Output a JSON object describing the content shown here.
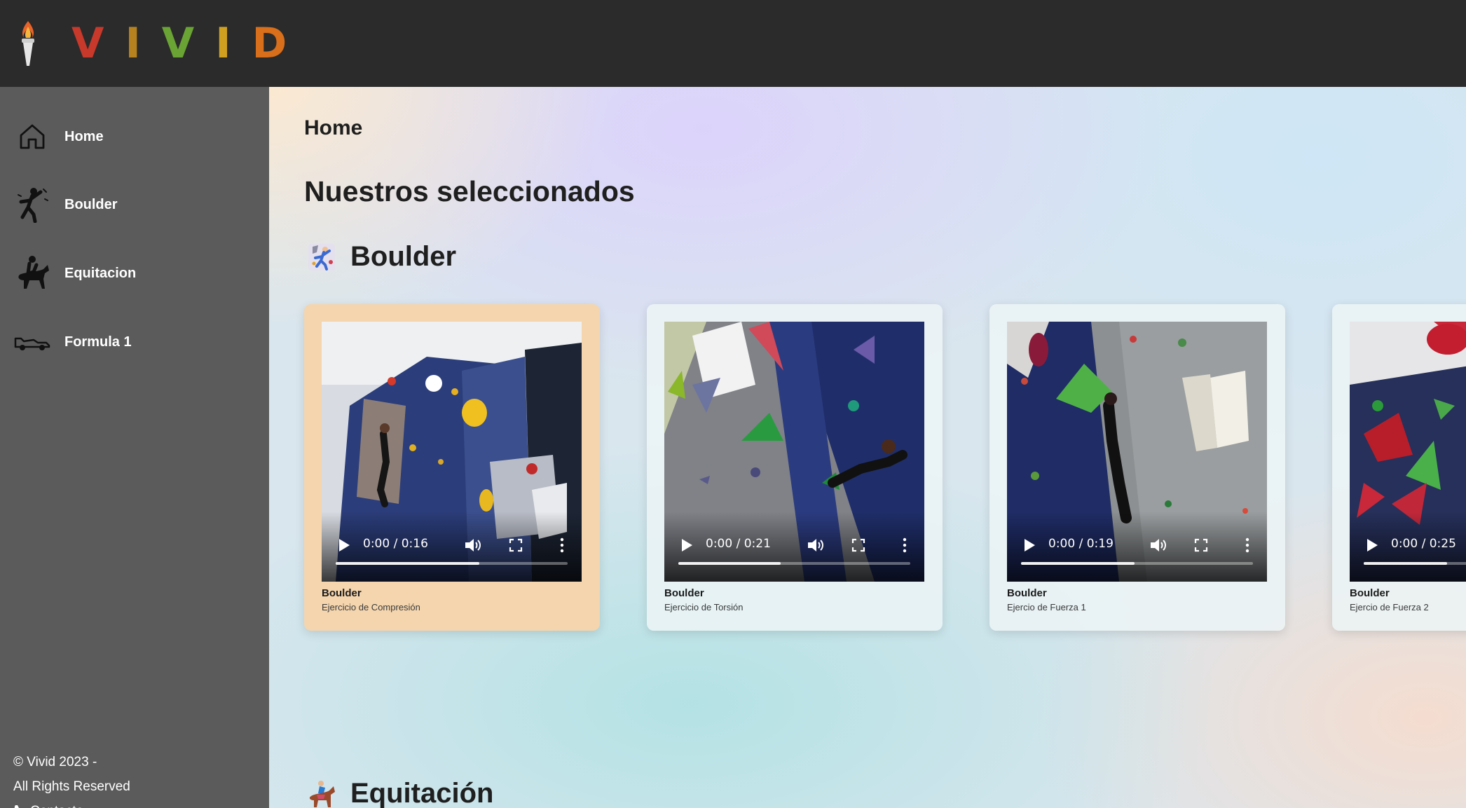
{
  "header": {
    "logo_text": [
      "V",
      "I",
      "V",
      "I",
      "D"
    ],
    "logo_colors": [
      "#c8392b",
      "#b5821f",
      "#6aa434",
      "#d0a020",
      "#d96f1a"
    ]
  },
  "sidebar": {
    "items": [
      {
        "label": "Home",
        "icon": "home-icon"
      },
      {
        "label": "Boulder",
        "icon": "climber-icon"
      },
      {
        "label": "Equitacion",
        "icon": "horse-rider-icon"
      },
      {
        "label": "Formula 1",
        "icon": "race-car-icon"
      }
    ],
    "footer": {
      "copyright": "© Vivid 2023 -",
      "rights": "All Rights Reserved",
      "contact": "Contacto"
    }
  },
  "main": {
    "breadcrumb": "Home",
    "section_title": "Nuestros seleccionados",
    "categories": [
      {
        "title": "Boulder",
        "icon": "climber-emoji-icon",
        "cards": [
          {
            "title": "Boulder",
            "subtitle": "Ejercicio de Compresión",
            "time": "0:00 / 0:16",
            "progress": 0.62,
            "active": true
          },
          {
            "title": "Boulder",
            "subtitle": "Ejercicio de Torsión",
            "time": "0:00 / 0:21",
            "progress": 0.44,
            "active": false
          },
          {
            "title": "Boulder",
            "subtitle": "Ejercio de Fuerza 1",
            "time": "0:00 / 0:19",
            "progress": 0.49,
            "active": false
          },
          {
            "title": "Boulder",
            "subtitle": "Ejercio de Fuerza 2",
            "time": "0:00 / 0:25",
            "progress": 0.36,
            "active": false
          }
        ]
      },
      {
        "title": "Equitación",
        "icon": "horse-rider-emoji-icon"
      }
    ]
  },
  "colors": {
    "topbar": "#2b2b2b",
    "sidebar": "#5b5b5b",
    "active_card": "#f4d5ae"
  }
}
